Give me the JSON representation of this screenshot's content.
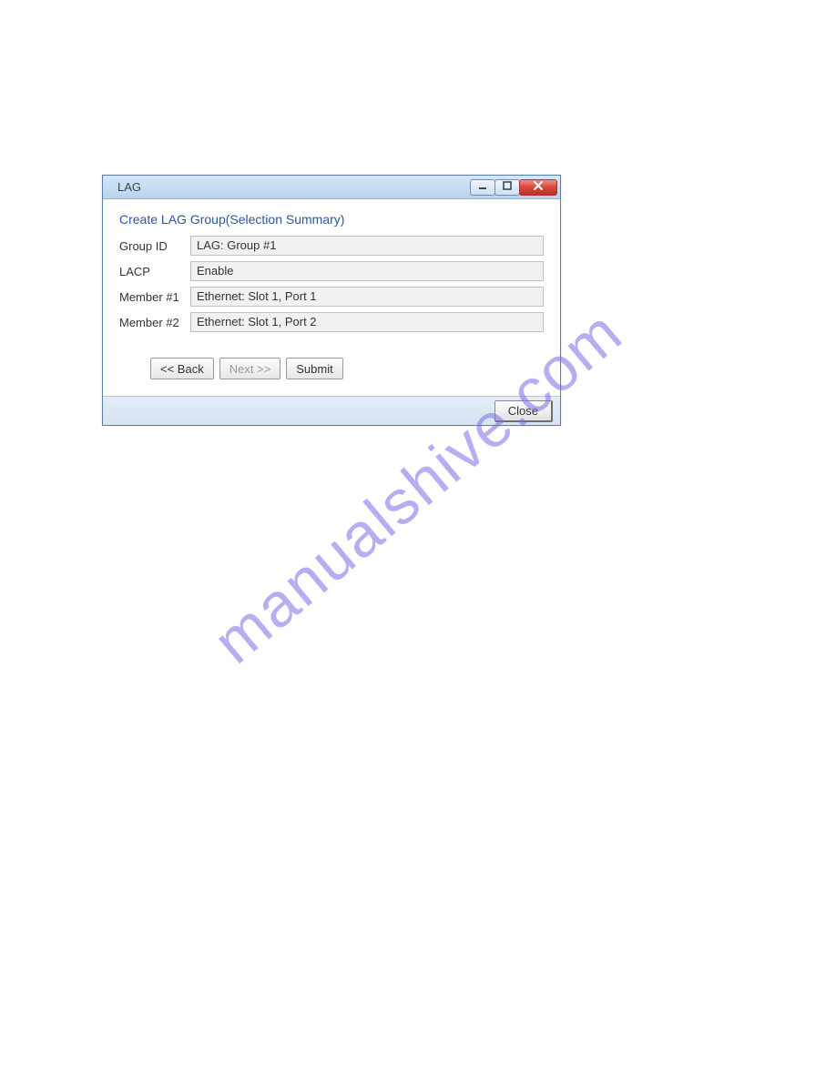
{
  "watermark": "manualshive.com",
  "window": {
    "title": "LAG",
    "section_title": "Create LAG Group(Selection Summary)",
    "fields": [
      {
        "label": "Group ID",
        "value": "LAG: Group #1"
      },
      {
        "label": "LACP",
        "value": "Enable"
      },
      {
        "label": "Member #1",
        "value": "Ethernet: Slot 1, Port 1"
      },
      {
        "label": "Member #2",
        "value": "Ethernet: Slot 1, Port 2"
      }
    ],
    "buttons": {
      "back": "<< Back",
      "next": "Next >>",
      "submit": "Submit",
      "close": "Close"
    }
  }
}
